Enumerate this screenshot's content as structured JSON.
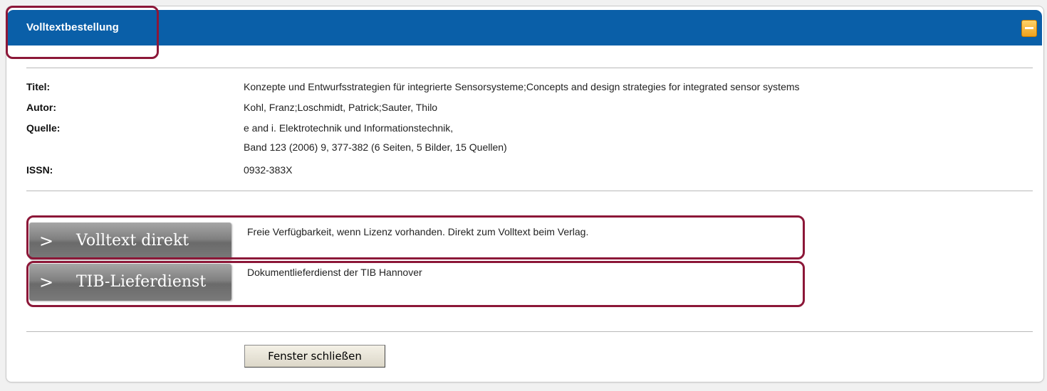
{
  "window": {
    "title": "Volltextbestellung"
  },
  "record": {
    "title_label": "Titel:",
    "title_value": "Konzepte und Entwurfsstrategien für integrierte Sensorsysteme;Concepts and design strategies for integrated sensor systems",
    "author_label": "Autor:",
    "author_value": "Kohl, Franz;Loschmidt, Patrick;Sauter, Thilo",
    "source_label": "Quelle:",
    "source_line1": "e and i. Elektrotechnik und Informationstechnik,",
    "source_line2": "Band 123 (2006) 9, 377-382 (6 Seiten, 5 Bilder, 15 Quellen)",
    "issn_label": "ISSN:",
    "issn_value": "0932-383X"
  },
  "options": [
    {
      "arrow": ">",
      "label": "Volltext direkt",
      "description": "Freie Verfügbarkeit, wenn Lizenz vorhanden. Direkt zum Volltext beim Verlag."
    },
    {
      "arrow": ">",
      "label": "TIB-Lieferdienst",
      "description": "Dokumentlieferdienst der TIB Hannover"
    }
  ],
  "footer": {
    "close_label": "Fenster schließen"
  },
  "colors": {
    "titlebar": "#0a5fa8",
    "highlight": "#8c1738",
    "minimize": "#f0a11c"
  }
}
